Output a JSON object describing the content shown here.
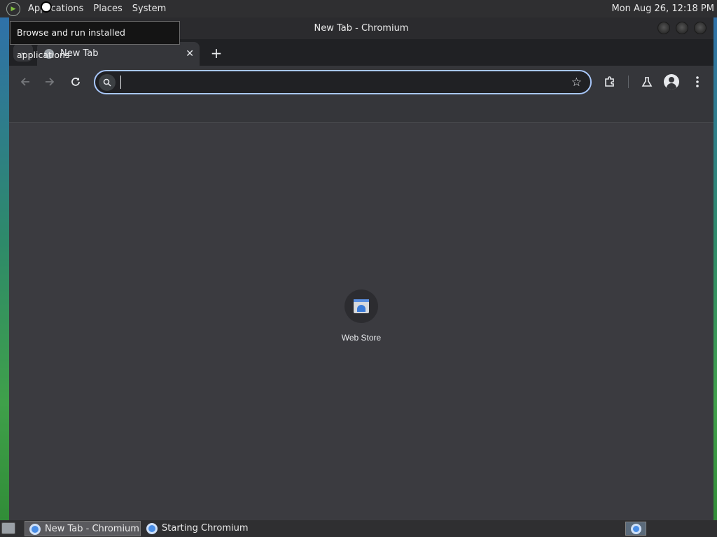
{
  "top_panel": {
    "menus": [
      "Applications",
      "Places",
      "System"
    ],
    "clock": "Mon Aug 26, 12:18 PM"
  },
  "tooltip": {
    "text": "Browse and run installed applications"
  },
  "window": {
    "title": "New Tab - Chromium"
  },
  "tabs": {
    "active": {
      "title": "New Tab",
      "close_glyph": "✕"
    },
    "new_tab_glyph": "+",
    "tab_search_glyph": "⌄"
  },
  "toolbar": {
    "back_icon": "arrow-left-icon",
    "forward_icon": "arrow-right-icon",
    "reload_icon": "reload-icon",
    "omnibox_value": "",
    "bookmark_icon": "star-icon",
    "extensions_icon": "puzzle-icon",
    "labs_icon": "flask-icon",
    "profile_icon": "avatar-icon",
    "menu_icon": "kebab-menu-icon"
  },
  "new_tab_page": {
    "shortcuts": [
      {
        "label": "Web Store",
        "icon": "webstore-icon"
      }
    ]
  },
  "taskbar": {
    "tasks": [
      {
        "label": "New Tab - Chromium",
        "active": true
      },
      {
        "label": "Starting Chromium",
        "active": false
      }
    ]
  },
  "colors": {
    "omnibox_focus_ring": "#a8c7fa",
    "content_bg": "#3b3b40",
    "toolbar_bg": "#35363a",
    "tabstrip_bg": "#202124"
  }
}
